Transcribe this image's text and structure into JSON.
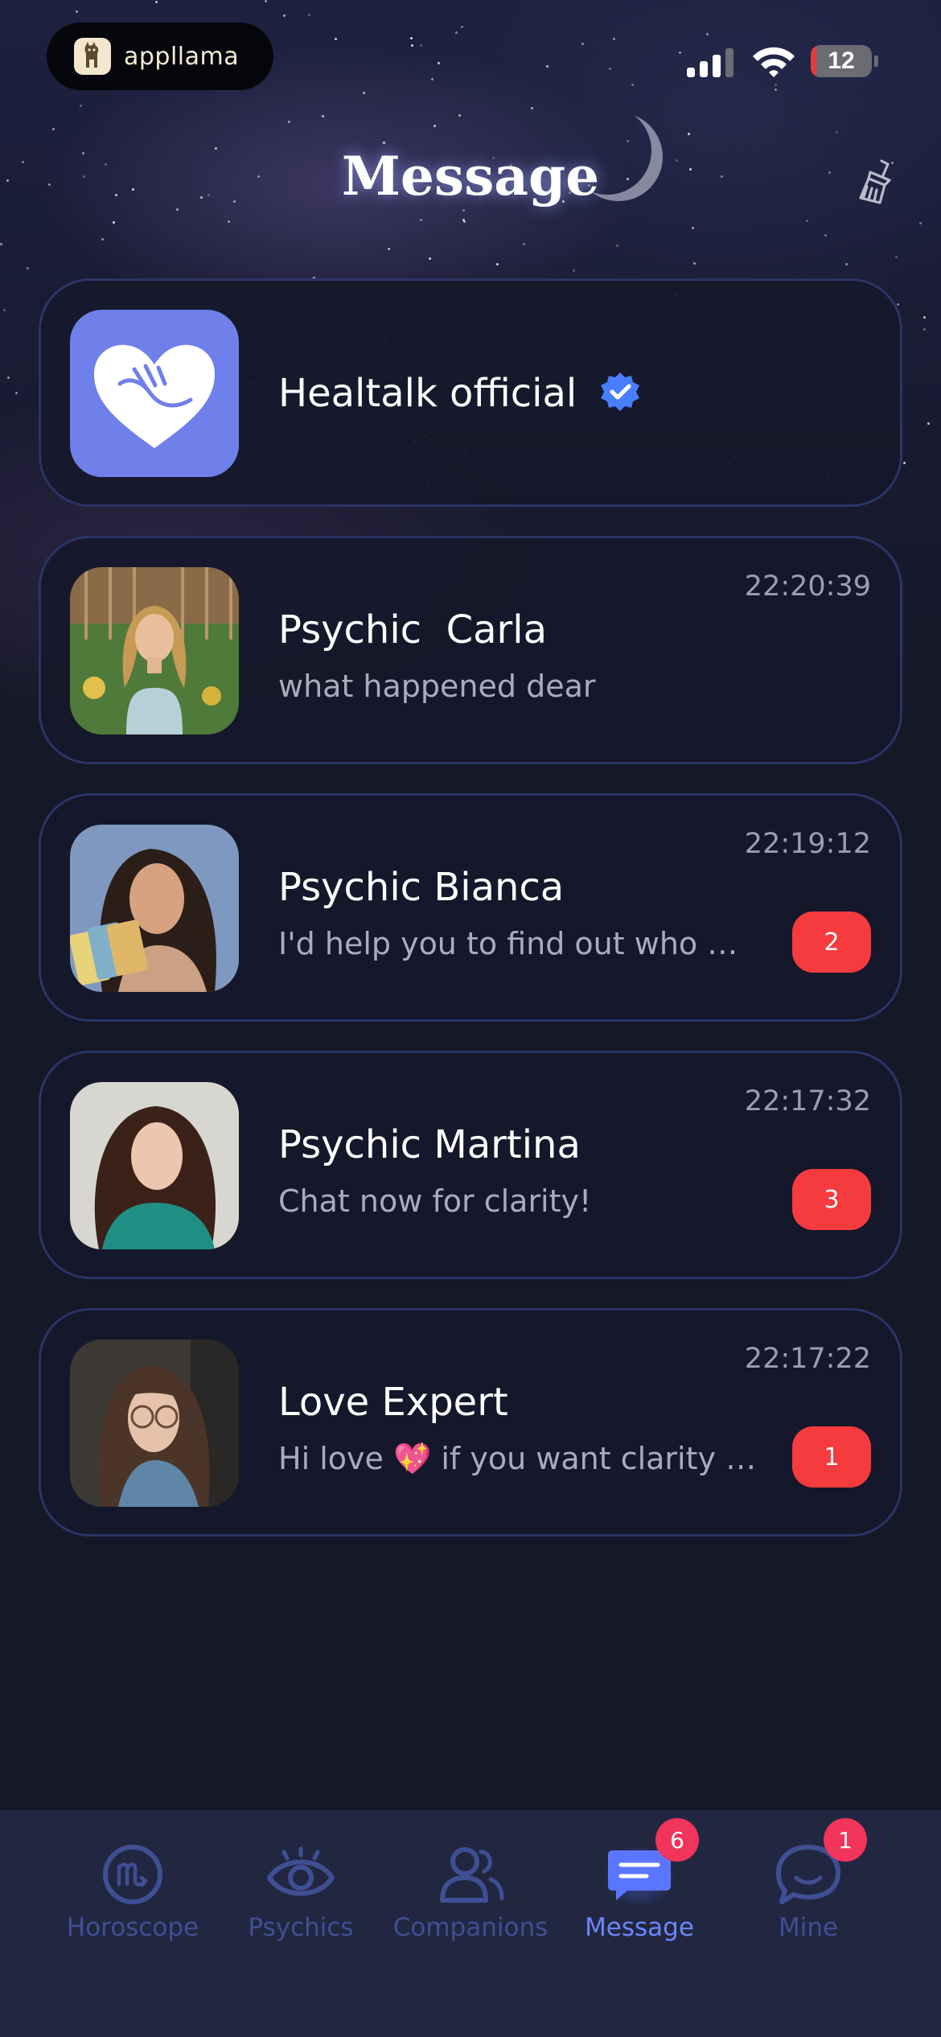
{
  "status_bar": {
    "app_pill_label": "appllama",
    "battery_level": "12",
    "battery_color": "#e23b3b"
  },
  "header": {
    "title": "Message",
    "clear_icon": "broom-icon"
  },
  "conversations": [
    {
      "name": "Healtalk official",
      "verified": true,
      "time": "",
      "preview": "",
      "badge": ""
    },
    {
      "name": "Psychic  Carla",
      "time": "22:20:39",
      "preview": "what happened dear",
      "badge": ""
    },
    {
      "name": "Psychic Bianca",
      "time": "22:19:12",
      "preview": "I'd help you to find out who will be with you in the end",
      "badge": "2"
    },
    {
      "name": "Psychic Martina",
      "time": "22:17:32",
      "preview": "Chat now for clarity!",
      "badge": "3"
    },
    {
      "name": "Love Expert",
      "time": "22:17:22",
      "preview": "Hi love 💖  if you want clarity about your love life",
      "badge": "1"
    }
  ],
  "bottom_nav": {
    "items": [
      {
        "label": "Horoscope",
        "icon": "scorpio-icon",
        "badge": ""
      },
      {
        "label": "Psychics",
        "icon": "eye-icon",
        "badge": ""
      },
      {
        "label": "Companions",
        "icon": "people-icon",
        "badge": ""
      },
      {
        "label": "Message",
        "icon": "message-icon",
        "badge": "6",
        "active": true
      },
      {
        "label": "Mine",
        "icon": "chat-bubble-icon",
        "badge": "1"
      }
    ]
  },
  "colors": {
    "background": "#151827",
    "card_border": "#2a3566",
    "badge_red": "#f63b3f",
    "nav_active": "#6b86ff",
    "nav_inactive": "#3f4f94",
    "official_avatar": "#6f80ea"
  }
}
